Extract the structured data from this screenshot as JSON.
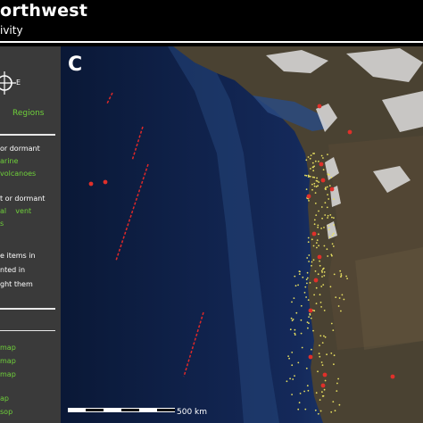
{
  "header": {
    "title": "orthwest",
    "subtitle": "ivity"
  },
  "sidebar": {
    "compass_label": "E",
    "regions_label": "Regions",
    "legend_a": [
      {
        "text": "or dormant",
        "color": "white"
      },
      {
        "text": "arine",
        "color": "green"
      },
      {
        "text": "volcanoes",
        "color": "green"
      }
    ],
    "legend_b": [
      {
        "text": "t or dormant",
        "color": "white"
      },
      {
        "text": "al    vent",
        "color": "green"
      },
      {
        "text": "s",
        "color": "green"
      }
    ],
    "note_lines": [
      "e items in",
      "nted in",
      "ght them"
    ],
    "links": [
      "map",
      "map",
      "map",
      "ap",
      "sop"
    ]
  },
  "map": {
    "panel_letter": "C",
    "scale_label": "500 km",
    "colors": {
      "ocean_deep": "#0a1a3a",
      "ocean_shelf": "#1d3a6b",
      "land": "#4a4030",
      "snow": "#d8d8d8",
      "volcano_red": "#e0302a",
      "quake_yellow": "#e8e060",
      "ridge_red": "#e02828"
    }
  }
}
